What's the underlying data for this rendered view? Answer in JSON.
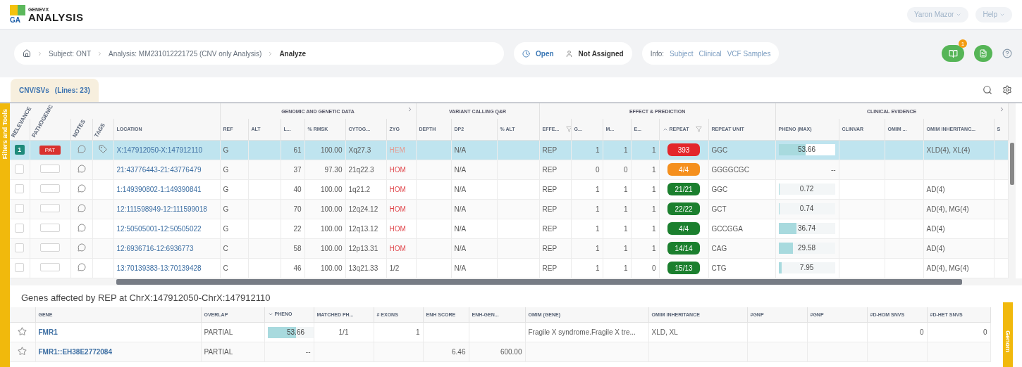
{
  "app": {
    "logo_text": "GA",
    "brand_small": "GENEVX",
    "brand": "ANALYSIS"
  },
  "user_menu": [
    {
      "label": "Yaron Mazor"
    },
    {
      "label": "Help"
    }
  ],
  "breadcrumb": [
    "Subject: ONT",
    "Analysis: MM231012221725 (CNV only Analysis)",
    "Analyze"
  ],
  "status": {
    "state": "Open",
    "assignee": "Not Assigned"
  },
  "info": {
    "label": "Info:",
    "links": [
      "Subject",
      "Clinical",
      "VCF Samples"
    ]
  },
  "actions": {
    "badge": "1"
  },
  "tabs": [
    {
      "label": "CNV/SVs",
      "count": "(Lines: 23)",
      "selected": true
    }
  ],
  "side_panels": {
    "left": "Filters and Tools",
    "right": "Genom"
  },
  "grid": {
    "groups": [
      {
        "columns": [
          {
            "label": "RELEVANCE",
            "kind": "relevance"
          },
          {
            "label": "PATHOGENIC",
            "kind": "pathogenic"
          },
          {
            "label": "NOTES",
            "kind": "notes"
          },
          {
            "label": "TAGS",
            "kind": "tags"
          },
          {
            "label": "LOCATION",
            "kind": "link"
          }
        ]
      },
      {
        "label": "GENOMIC AND GENETIC DATA",
        "expandable": true,
        "columns": [
          {
            "label": "REF",
            "kind": "text"
          },
          {
            "label": "ALT",
            "kind": "text"
          },
          {
            "label": "L...",
            "kind": "num"
          },
          {
            "label": "% RMSK",
            "kind": "num"
          },
          {
            "label": "CYTOG...",
            "kind": "text"
          },
          {
            "label": "ZYG",
            "kind": "text"
          }
        ]
      },
      {
        "label": "VARIANT CALLING Q&R",
        "expandable": false,
        "columns": [
          {
            "label": "DEPTH",
            "kind": "text"
          },
          {
            "label": "DP2",
            "kind": "text"
          },
          {
            "label": "% ALT",
            "kind": "text"
          }
        ]
      },
      {
        "label": "EFFECT & PREDICTION",
        "expandable": false,
        "columns": [
          {
            "label": "EFFE...",
            "kind": "text",
            "filter": true
          },
          {
            "label": "G...",
            "kind": "num"
          },
          {
            "label": "M...",
            "kind": "num"
          },
          {
            "label": "E...",
            "kind": "num"
          },
          {
            "label": "REPEAT",
            "kind": "badge",
            "sorted": true,
            "descending": false,
            "filter": true
          },
          {
            "label": "REPEAT UNIT",
            "kind": "text"
          }
        ]
      },
      {
        "label": "CLINICAL EVIDENCE",
        "expandable": true,
        "columns": [
          {
            "label": "PHENO (MAX)",
            "kind": "bar"
          },
          {
            "label": "CLINVAR",
            "kind": "text"
          },
          {
            "label": "OMIM ...",
            "kind": "text"
          },
          {
            "label": "OMIM INHERITANC...",
            "kind": "text"
          },
          {
            "label": "S",
            "kind": "text"
          }
        ]
      }
    ],
    "rows": [
      {
        "selected": true,
        "cells": [
          {
            "text": "1",
            "checked": true
          },
          {
            "text": "PAT",
            "checked": true
          },
          null,
          {
            "tagged": true
          },
          "X:147912050-X:147912110",
          "G",
          null,
          "61",
          "100.00",
          "Xq27.3",
          {
            "text": "HEM",
            "color": "#e59a8f"
          },
          null,
          "N/A",
          null,
          "REP",
          "1",
          "1",
          "1",
          {
            "text": "393",
            "color": "#e3262b"
          },
          "GGC",
          {
            "text": "53.66",
            "level": 0.48
          },
          null,
          null,
          "XLD(4), XL(4)",
          null
        ]
      },
      {
        "selected": false,
        "cells": [
          {
            "checked": false
          },
          {
            "checked": false
          },
          null,
          {
            "tagged": false
          },
          "21:43776443-21:43776479",
          "G",
          null,
          "37",
          "97.30",
          "21q22.3",
          {
            "text": "HOM",
            "color": "#e0474c"
          },
          null,
          "N/A",
          null,
          "REP",
          "0",
          "0",
          "1",
          {
            "text": "4/4",
            "color": "#f5901e"
          },
          "GGGGCGC",
          "--",
          null,
          null,
          null,
          null
        ]
      },
      {
        "selected": false,
        "cells": [
          {
            "checked": false
          },
          {
            "checked": false
          },
          null,
          {
            "tagged": false
          },
          "1:149390802-1:149390841",
          "G",
          null,
          "40",
          "100.00",
          "1q21.2",
          {
            "text": "HOM",
            "color": "#e0474c"
          },
          null,
          "N/A",
          null,
          "REP",
          "1",
          "1",
          "1",
          {
            "text": "21/21",
            "color": "#1b7f2e"
          },
          "GGC",
          {
            "text": "0.72",
            "level": 0.01
          },
          null,
          null,
          "AD(4)",
          null
        ]
      },
      {
        "selected": false,
        "cells": [
          {
            "checked": false
          },
          {
            "checked": false
          },
          null,
          {
            "tagged": false
          },
          "12:111598949-12:111599018",
          "G",
          null,
          "70",
          "100.00",
          "12q24.12",
          {
            "text": "HOM",
            "color": "#e0474c"
          },
          null,
          "N/A",
          null,
          "REP",
          "1",
          "1",
          "1",
          {
            "text": "22/22",
            "color": "#1b7f2e"
          },
          "GCT",
          {
            "text": "0.74",
            "level": 0.01
          },
          null,
          null,
          "AD(4), MG(4)",
          null
        ]
      },
      {
        "selected": false,
        "cells": [
          {
            "checked": false
          },
          {
            "checked": false
          },
          null,
          {
            "tagged": false
          },
          "12:50505001-12:50505022",
          "G",
          null,
          "22",
          "100.00",
          "12q13.12",
          {
            "text": "HOM",
            "color": "#e0474c"
          },
          null,
          "N/A",
          null,
          "REP",
          "1",
          "1",
          "1",
          {
            "text": "4/4",
            "color": "#1b7f2e"
          },
          "GCCGGA",
          {
            "text": "36.74",
            "level": 0.32
          },
          null,
          null,
          "AD(4)",
          null
        ]
      },
      {
        "selected": false,
        "cells": [
          {
            "checked": false
          },
          {
            "checked": false
          },
          null,
          {
            "tagged": false
          },
          "12:6936716-12:6936773",
          "C",
          null,
          "58",
          "100.00",
          "12p13.31",
          {
            "text": "HOM",
            "color": "#e0474c"
          },
          null,
          "N/A",
          null,
          "REP",
          "1",
          "1",
          "1",
          {
            "text": "14/14",
            "color": "#1b7f2e"
          },
          "CAG",
          {
            "text": "29.58",
            "level": 0.26
          },
          null,
          null,
          "AD(4)",
          null
        ]
      },
      {
        "selected": false,
        "cells": [
          {
            "checked": false
          },
          {
            "checked": false
          },
          null,
          {
            "tagged": false
          },
          "13:70139383-13:70139428",
          "C",
          null,
          "46",
          "100.00",
          "13q21.33",
          "1/2",
          null,
          "N/A",
          null,
          "REP",
          "1",
          "1",
          "0",
          {
            "text": "15/13",
            "color": "#1b7f2e"
          },
          "CTG",
          {
            "text": "7.95",
            "level": 0.06
          },
          null,
          null,
          "AD(4), MG(4)",
          null
        ]
      }
    ]
  },
  "genes": {
    "title": "Genes affected by REP at ChrX:147912050-ChrX:147912110",
    "columns": [
      {
        "label": "GENE",
        "kind": "link"
      },
      {
        "label": "OVERLAP",
        "kind": "text"
      },
      {
        "label": "PHENO",
        "kind": "bar",
        "sorted": true,
        "descending": true
      },
      {
        "label": "MATCHED PH...",
        "kind": "center"
      },
      {
        "label": "# EXONS",
        "kind": "num"
      },
      {
        "label": "ENH SCORE",
        "kind": "num"
      },
      {
        "label": "ENH-GEN...",
        "kind": "num"
      },
      {
        "label": "OMIM (GENE)",
        "kind": "text"
      },
      {
        "label": "OMIM INHERITANCE",
        "kind": "text"
      },
      {
        "label": "#GNP",
        "kind": "num"
      },
      {
        "label": "#GNP",
        "kind": "num"
      },
      {
        "label": "#D-HOM SNVS",
        "kind": "num"
      },
      {
        "label": "#D-HET SNVS",
        "kind": "num"
      }
    ],
    "rows": [
      {
        "starred": false,
        "cells": [
          "FMR1",
          "PARTIAL",
          {
            "text": "53.66",
            "level": 0.5
          },
          "1/1",
          "1",
          null,
          null,
          "Fragile X syndrome.Fragile X tre...",
          "XLD, XL",
          null,
          null,
          "0",
          "0"
        ]
      },
      {
        "starred": false,
        "cells": [
          "FMR1::EH38E2772084",
          "PARTIAL",
          "--",
          null,
          null,
          "6.46",
          "600.00",
          null,
          null,
          null,
          null,
          null,
          null
        ]
      }
    ]
  }
}
